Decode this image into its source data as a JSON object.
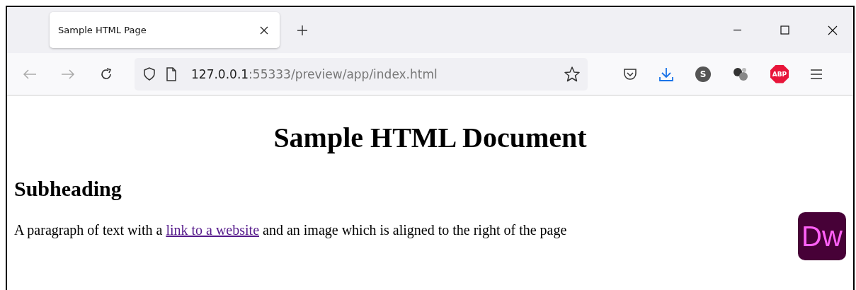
{
  "tabs": [
    {
      "title": "Sample HTML Page",
      "selected": true
    }
  ],
  "address": {
    "host": "127.0.0.1",
    "rest": ":55333/preview/app/index.html"
  },
  "toolbar_badges": {
    "account": "S",
    "adblock": "ABP"
  },
  "page": {
    "heading": "Sample HTML Document",
    "subheading": "Subheading",
    "paragraph_before": "A paragraph of text with a ",
    "link": "link to a website",
    "paragraph_after": " and an image which is aligned to the right of the page",
    "image_text": "Dw"
  }
}
